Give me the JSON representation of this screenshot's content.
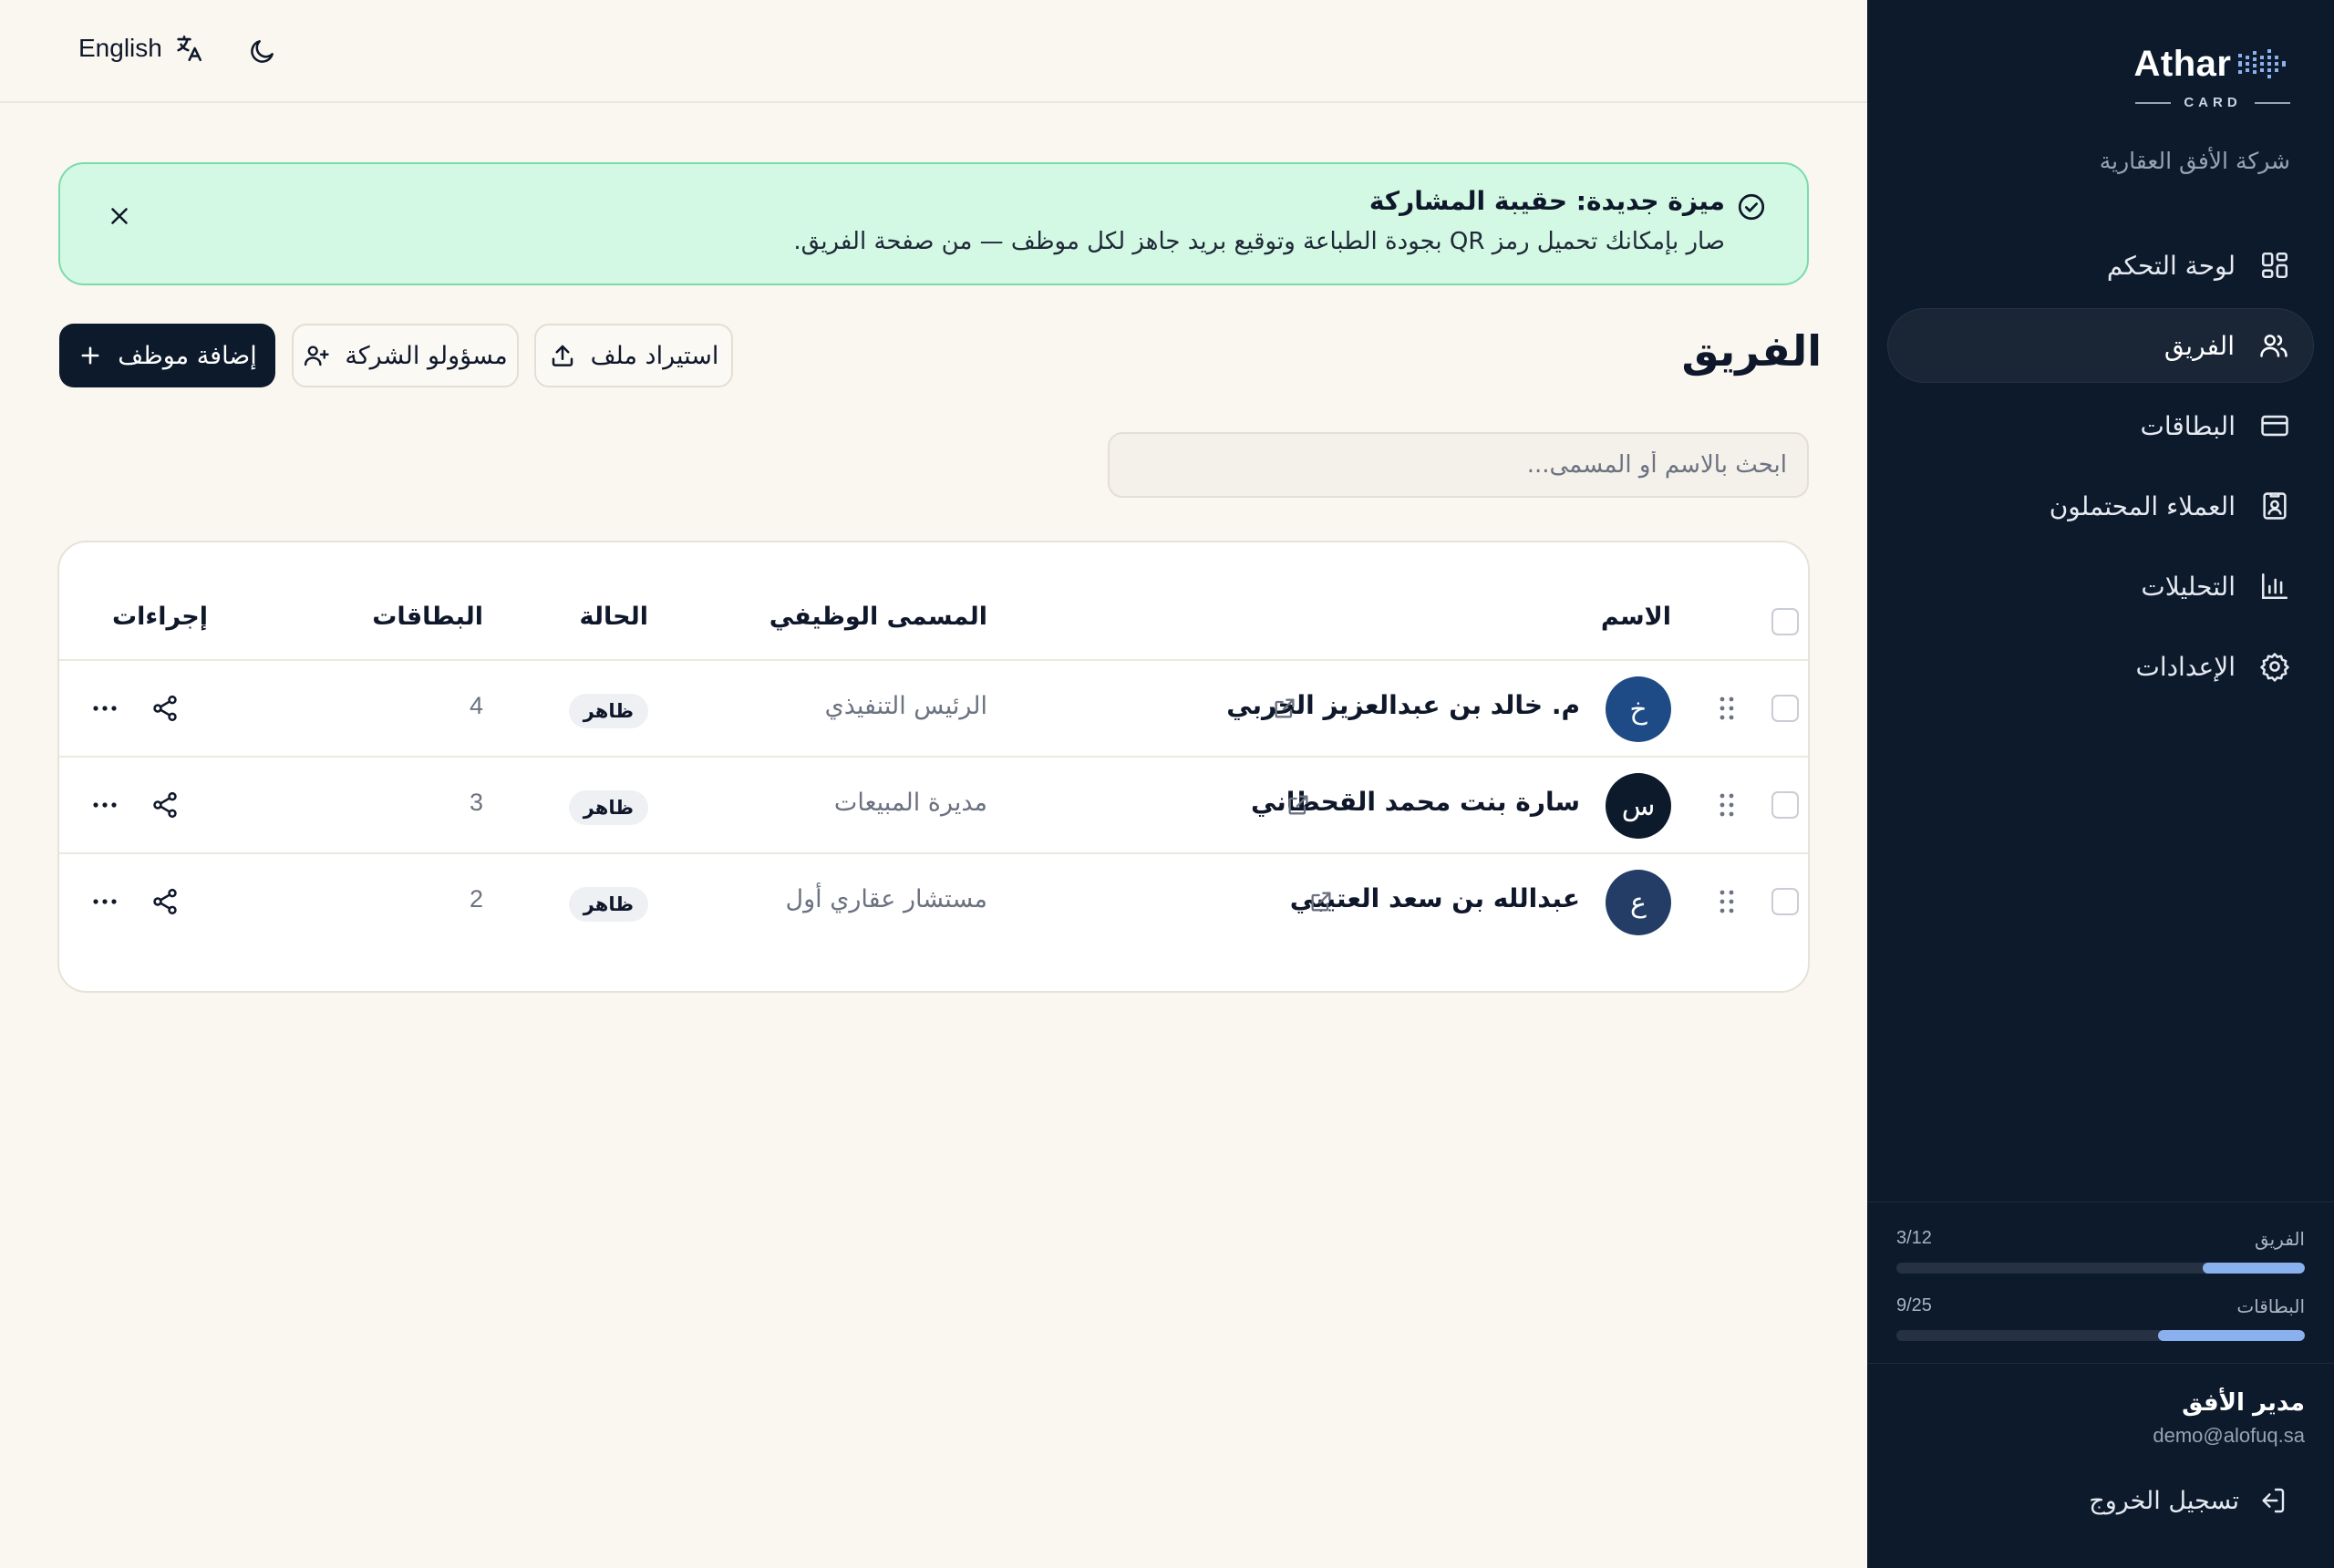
{
  "topbar": {
    "language_label": "English"
  },
  "sidebar": {
    "brand_name": "Athar",
    "brand_sub": "CARD",
    "company": "شركة الأفق العقارية",
    "items": [
      {
        "label": "لوحة التحكم",
        "icon": "dashboard-icon",
        "active": false
      },
      {
        "label": "الفريق",
        "icon": "users-icon",
        "active": true
      },
      {
        "label": "البطاقات",
        "icon": "card-icon",
        "active": false
      },
      {
        "label": "العملاء المحتملون",
        "icon": "contact-icon",
        "active": false
      },
      {
        "label": "التحليلات",
        "icon": "bar-chart-icon",
        "active": false
      },
      {
        "label": "الإعدادات",
        "icon": "gear-icon",
        "active": false
      }
    ],
    "usage": [
      {
        "label": "الفريق",
        "value": "3/12",
        "fraction": 0.25
      },
      {
        "label": "البطاقات",
        "value": "9/25",
        "fraction": 0.36
      }
    ],
    "user": {
      "name": "مدير الأفق",
      "email": "demo@alofuq.sa"
    },
    "logout_label": "تسجيل الخروج"
  },
  "banner": {
    "title": "ميزة جديدة: حقيبة المشاركة",
    "text": "صار بإمكانك تحميل رمز QR بجودة الطباعة وتوقيع بريد جاهز لكل موظف — من صفحة الفريق."
  },
  "page": {
    "title": "الفريق",
    "add_employee": "إضافة موظف",
    "company_admins": "مسؤولو الشركة",
    "import_file": "استيراد ملف",
    "search_placeholder": "ابحث بالاسم أو المسمى..."
  },
  "table": {
    "headers": {
      "name": "الاسم",
      "job_title": "المسمى الوظيفي",
      "status": "الحالة",
      "cards": "البطاقات",
      "actions": "إجراءات"
    },
    "rows": [
      {
        "initial": "خ",
        "avatar_color": "#1e4b86",
        "name": "م. خالد بن عبدالعزيز الحربي",
        "title": "الرئيس التنفيذي",
        "status": "ظاهر",
        "cards": "4"
      },
      {
        "initial": "س",
        "avatar_color": "#0c1a2c",
        "name": "سارة بنت محمد القحطاني",
        "title": "مديرة المبيعات",
        "status": "ظاهر",
        "cards": "3"
      },
      {
        "initial": "ع",
        "avatar_color": "#243d66",
        "name": "عبدالله بن سعد العتيبي",
        "title": "مستشار عقاري أول",
        "status": "ظاهر",
        "cards": "2"
      }
    ]
  }
}
